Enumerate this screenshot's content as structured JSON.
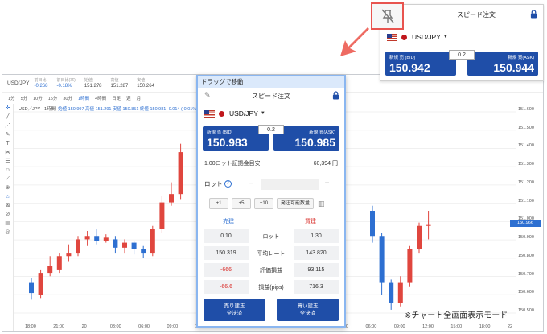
{
  "colors": {
    "accent_blue": "#1f4ea8",
    "down_blue": "#2d6fd1",
    "up_red": "#e0463e",
    "drag_bar": "#dbe9fb",
    "highlight_red": "#e8544f"
  },
  "chart": {
    "symbol": "USD/JPY",
    "quote_bar": [
      {
        "label": "前日比",
        "value": "-0.268",
        "negative": true
      },
      {
        "label": "前日比(率)",
        "value": "-0.18%",
        "negative": true
      },
      {
        "label": "始値",
        "value": "151.278",
        "negative": false
      },
      {
        "label": "高値",
        "value": "151.287",
        "negative": false
      },
      {
        "label": "安値",
        "value": "150.264",
        "negative": false
      }
    ],
    "timeframes": [
      "1分",
      "5分",
      "10分",
      "15分",
      "30分",
      "1時間",
      "4時間",
      "日足",
      "週",
      "月"
    ],
    "selected_timeframe": "1時間",
    "legend_symbol": "USD／JPY · 1時間",
    "legend_values": "始値 150.997  高値 151.291  安値 150.851  終値 150.981  -0.014 (-0.01%)",
    "price_tag": "150.966",
    "y_ticks": [
      "151.600",
      "151.500",
      "151.400",
      "151.300",
      "151.200",
      "151.100",
      "151.000",
      "150.900",
      "150.800",
      "150.700",
      "150.600",
      "150.500"
    ],
    "x_ticks": [
      "18:00",
      "21:00",
      "20",
      "03:00",
      "06:00",
      "09:00",
      "12:00",
      "15:00",
      "18:00",
      "21:00",
      "21",
      "03:00",
      "06:00",
      "09:00",
      "12:00",
      "15:00",
      "18:00",
      "22"
    ],
    "caption": "※チャート全画面表示モード",
    "tool_icons": [
      "crosshair-icon",
      "line-icon",
      "fib-icon",
      "brush-icon",
      "text-icon",
      "pattern-icon",
      "measure-icon",
      "emoji-icon",
      "ruler-icon",
      "zoom-icon",
      "magnet-icon",
      "lock-draw-icon",
      "hide-icon",
      "trash-icon",
      "settings-icon"
    ]
  },
  "panel": {
    "drag_label": "ドラッグで移動",
    "title": "スピード注文",
    "pair": "USD/JPY",
    "bid_label": "新規 売 (BID)",
    "bid_price": "150.983",
    "ask_label": "新規 買(ASK)",
    "ask_price": "150.985",
    "spread": "0.2",
    "margin_label": "1.00ロット証拠金目安",
    "margin_value": "60,394 円",
    "lot_label": "ロット",
    "lot_value": "",
    "quick_buttons": [
      "+1",
      "+5",
      "+10",
      "発注可能数量"
    ],
    "sell_header": "売建",
    "buy_header": "買建",
    "positions": [
      {
        "sell": "0.10",
        "label": "ロット",
        "buy": "1.30",
        "red": false
      },
      {
        "sell": "150.319",
        "label": "平均レート",
        "buy": "143.820",
        "red": false
      },
      {
        "sell": "-666",
        "label": "評価損益",
        "buy": "93,115",
        "red": true
      },
      {
        "sell": "-66.6",
        "label": "損益(pips)",
        "buy": "716.3",
        "red": true
      }
    ],
    "close_sell_1": "売り建玉",
    "close_sell_2": "全決済",
    "close_buy_1": "買い建玉",
    "close_buy_2": "全決済"
  },
  "dock": {
    "title": "スピード注文",
    "pair": "USD/JPY",
    "bid_label": "新規 売 (BID)",
    "bid_price": "150.942",
    "ask_label": "新規 買(ASK)",
    "ask_price": "150.944",
    "spread": "0.2"
  },
  "chart_data": {
    "type": "candlestick",
    "ylim": [
      150.45,
      151.65
    ],
    "candles": [
      {
        "o": 150.62,
        "c": 150.56,
        "h": 150.65,
        "l": 150.52
      },
      {
        "o": 150.55,
        "c": 150.68,
        "h": 150.7,
        "l": 150.53
      },
      {
        "o": 150.68,
        "c": 150.72,
        "h": 150.78,
        "l": 150.66
      },
      {
        "o": 150.7,
        "c": 150.78,
        "h": 150.8,
        "l": 150.68
      },
      {
        "o": 150.78,
        "c": 150.8,
        "h": 150.85,
        "l": 150.75
      },
      {
        "o": 150.8,
        "c": 150.88,
        "h": 150.9,
        "l": 150.78
      },
      {
        "o": 150.88,
        "c": 150.9,
        "h": 150.93,
        "l": 150.84
      },
      {
        "o": 150.9,
        "c": 150.87,
        "h": 150.94,
        "l": 150.85
      },
      {
        "o": 150.87,
        "c": 150.89,
        "h": 150.91,
        "l": 150.86
      },
      {
        "o": 150.88,
        "c": 150.83,
        "h": 150.9,
        "l": 150.8
      },
      {
        "o": 150.83,
        "c": 150.86,
        "h": 150.88,
        "l": 150.8
      },
      {
        "o": 150.86,
        "c": 150.82,
        "h": 150.87,
        "l": 150.79
      },
      {
        "o": 150.82,
        "c": 150.8,
        "h": 150.84,
        "l": 150.77
      },
      {
        "o": 150.8,
        "c": 150.94,
        "h": 150.96,
        "l": 150.78
      },
      {
        "o": 150.94,
        "c": 151.1,
        "h": 151.14,
        "l": 150.92
      },
      {
        "o": 151.1,
        "c": 151.15,
        "h": 151.22,
        "l": 151.08
      },
      {
        "o": 151.15,
        "c": 151.4,
        "h": 151.45,
        "l": 151.12
      }
    ],
    "candles_right": [
      {
        "o": 151.05,
        "c": 150.9,
        "h": 151.08,
        "l": 150.86
      },
      {
        "o": 150.9,
        "c": 150.62,
        "h": 150.92,
        "l": 150.55
      },
      {
        "o": 150.62,
        "c": 150.5,
        "h": 150.64,
        "l": 150.46
      },
      {
        "o": 150.5,
        "c": 150.62,
        "h": 150.66,
        "l": 150.48
      },
      {
        "o": 150.62,
        "c": 150.82,
        "h": 150.84,
        "l": 150.6
      },
      {
        "o": 150.82,
        "c": 150.96,
        "h": 150.98,
        "l": 150.8
      },
      {
        "o": 150.96,
        "c": 150.97,
        "h": 151.05,
        "l": 150.88
      }
    ]
  }
}
